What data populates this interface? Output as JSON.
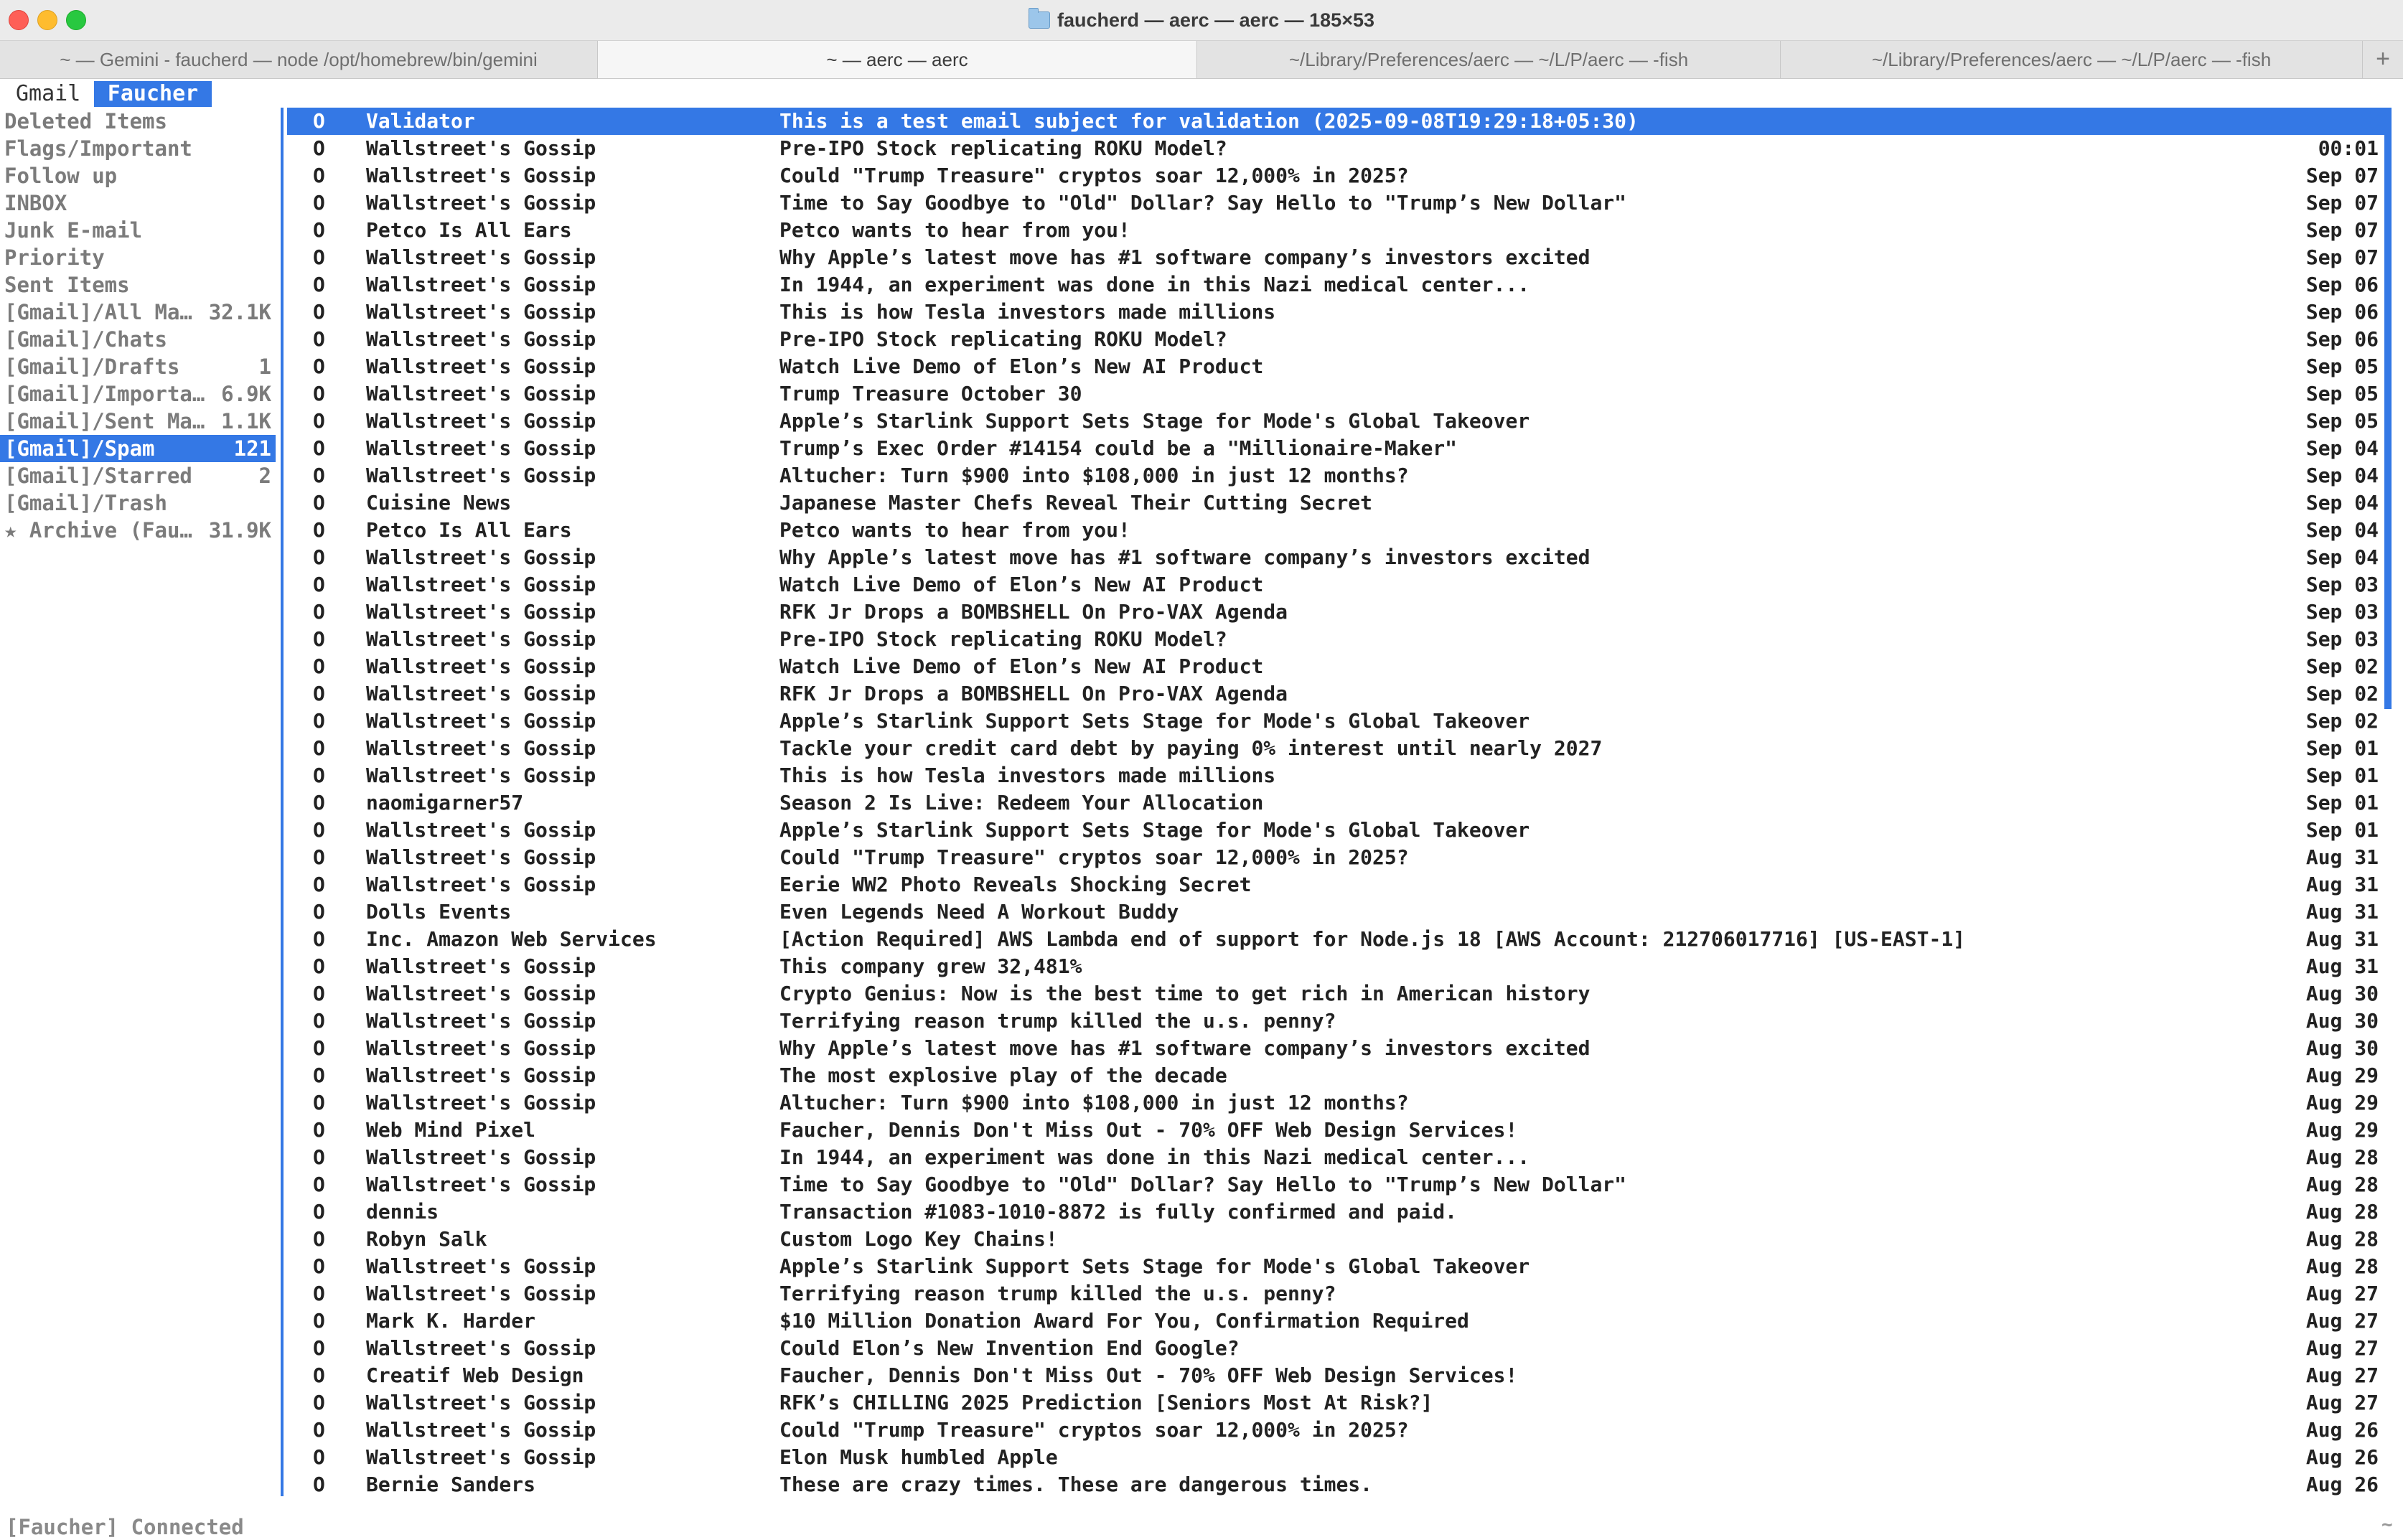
{
  "window": {
    "title": "faucherd — aerc — aerc — 185×53",
    "tabs": [
      {
        "label": "~ —  Gemini - faucherd  — node /opt/homebrew/bin/gemini"
      },
      {
        "label": "~ — aerc — aerc"
      },
      {
        "label": "~/Library/Preferences/aerc — ~/L/P/aerc — -fish"
      },
      {
        "label": "~/Library/Preferences/aerc — ~/L/P/aerc — -fish"
      }
    ],
    "new_tab_label": "+"
  },
  "accounts": [
    "Gmail",
    "Faucher"
  ],
  "folders": [
    {
      "name": "Deleted Items",
      "count": ""
    },
    {
      "name": "Flags/Important",
      "count": ""
    },
    {
      "name": "Follow up",
      "count": ""
    },
    {
      "name": "INBOX",
      "count": ""
    },
    {
      "name": "Junk E-mail",
      "count": ""
    },
    {
      "name": "Priority",
      "count": ""
    },
    {
      "name": "Sent Items",
      "count": ""
    },
    {
      "name": "[Gmail]/All Ma…",
      "count": "32.1K"
    },
    {
      "name": "[Gmail]/Chats",
      "count": ""
    },
    {
      "name": "[Gmail]/Drafts",
      "count": "1"
    },
    {
      "name": "[Gmail]/Importa…",
      "count": "6.9K"
    },
    {
      "name": "[Gmail]/Sent Ma…",
      "count": "1.1K"
    },
    {
      "name": "[Gmail]/Spam",
      "count": "121"
    },
    {
      "name": "[Gmail]/Starred",
      "count": "2"
    },
    {
      "name": "[Gmail]/Trash",
      "count": ""
    },
    {
      "name": "★ Archive (Fau…",
      "count": "31.9K"
    }
  ],
  "messages": [
    {
      "flag": "O",
      "from": "Validator",
      "subject": "This is a test email subject for validation (2025-09-08T19:29:18+05:30)",
      "date": ""
    },
    {
      "flag": "O",
      "from": "Wallstreet's Gossip",
      "subject": "Pre-IPO Stock replicating ROKU Model?",
      "date": "00:01"
    },
    {
      "flag": "O",
      "from": "Wallstreet's Gossip",
      "subject": "Could \"Trump Treasure\" cryptos soar 12,000% in 2025?",
      "date": "Sep 07"
    },
    {
      "flag": "O",
      "from": "Wallstreet's Gossip",
      "subject": "Time to Say Goodbye to \"Old\" Dollar? Say Hello to \"Trump’s New Dollar\"",
      "date": "Sep 07"
    },
    {
      "flag": "O",
      "from": "Petco Is All Ears",
      "subject": "Petco wants to hear from you!",
      "date": "Sep 07"
    },
    {
      "flag": "O",
      "from": "Wallstreet's Gossip",
      "subject": "Why Apple’s latest move has #1 software company’s investors excited",
      "date": "Sep 07"
    },
    {
      "flag": "O",
      "from": "Wallstreet's Gossip",
      "subject": "In 1944, an experiment was done in this Nazi medical center...",
      "date": "Sep 06"
    },
    {
      "flag": "O",
      "from": "Wallstreet's Gossip",
      "subject": "This is how Tesla investors made millions",
      "date": "Sep 06"
    },
    {
      "flag": "O",
      "from": "Wallstreet's Gossip",
      "subject": "Pre-IPO Stock replicating ROKU Model?",
      "date": "Sep 06"
    },
    {
      "flag": "O",
      "from": "Wallstreet's Gossip",
      "subject": "Watch Live Demo of Elon’s New AI Product",
      "date": "Sep 05"
    },
    {
      "flag": "O",
      "from": "Wallstreet's Gossip",
      "subject": "Trump Treasure October 30",
      "date": "Sep 05"
    },
    {
      "flag": "O",
      "from": "Wallstreet's Gossip",
      "subject": "Apple’s Starlink Support Sets Stage for Mode's Global Takeover",
      "date": "Sep 05"
    },
    {
      "flag": "O",
      "from": "Wallstreet's Gossip",
      "subject": "Trump’s Exec Order #14154 could be a \"Millionaire-Maker\"",
      "date": "Sep 04"
    },
    {
      "flag": "O",
      "from": "Wallstreet's Gossip",
      "subject": "Altucher: Turn $900 into $108,000 in just 12 months?",
      "date": "Sep 04"
    },
    {
      "flag": "O",
      "from": "Cuisine News",
      "subject": "Japanese Master Chefs Reveal Their Cutting Secret",
      "date": "Sep 04"
    },
    {
      "flag": "O",
      "from": "Petco Is All Ears",
      "subject": "Petco wants to hear from you!",
      "date": "Sep 04"
    },
    {
      "flag": "O",
      "from": "Wallstreet's Gossip",
      "subject": "Why Apple’s latest move has #1 software company’s investors excited",
      "date": "Sep 04"
    },
    {
      "flag": "O",
      "from": "Wallstreet's Gossip",
      "subject": "Watch Live Demo of Elon’s New AI Product",
      "date": "Sep 03"
    },
    {
      "flag": "O",
      "from": "Wallstreet's Gossip",
      "subject": "RFK Jr Drops a BOMBSHELL On Pro-VAX Agenda",
      "date": "Sep 03"
    },
    {
      "flag": "O",
      "from": "Wallstreet's Gossip",
      "subject": "Pre-IPO Stock replicating ROKU Model?",
      "date": "Sep 03"
    },
    {
      "flag": "O",
      "from": "Wallstreet's Gossip",
      "subject": "Watch Live Demo of Elon’s New AI Product",
      "date": "Sep 02"
    },
    {
      "flag": "O",
      "from": "Wallstreet's Gossip",
      "subject": "RFK Jr Drops a BOMBSHELL On Pro-VAX Agenda",
      "date": "Sep 02"
    },
    {
      "flag": "O",
      "from": "Wallstreet's Gossip",
      "subject": "Apple’s Starlink Support Sets Stage for Mode's Global Takeover",
      "date": "Sep 02"
    },
    {
      "flag": "O",
      "from": "Wallstreet's Gossip",
      "subject": "Tackle your credit card debt by paying 0% interest until nearly 2027",
      "date": "Sep 01"
    },
    {
      "flag": "O",
      "from": "Wallstreet's Gossip",
      "subject": "This is how Tesla investors made millions",
      "date": "Sep 01"
    },
    {
      "flag": "O",
      "from": "naomigarner57",
      "subject": "Season 2 Is Live: Redeem Your Allocation",
      "date": "Sep 01"
    },
    {
      "flag": "O",
      "from": "Wallstreet's Gossip",
      "subject": "Apple’s Starlink Support Sets Stage for Mode's Global Takeover",
      "date": "Sep 01"
    },
    {
      "flag": "O",
      "from": "Wallstreet's Gossip",
      "subject": "Could \"Trump Treasure\" cryptos soar 12,000% in 2025?",
      "date": "Aug 31"
    },
    {
      "flag": "O",
      "from": "Wallstreet's Gossip",
      "subject": "Eerie WW2 Photo Reveals Shocking Secret",
      "date": "Aug 31"
    },
    {
      "flag": "O",
      "from": "Dolls Events",
      "subject": "Even Legends Need A Workout Buddy",
      "date": "Aug 31"
    },
    {
      "flag": "O",
      "from": "Inc. Amazon Web Services",
      "subject": "[Action Required] AWS Lambda end of support for Node.js 18 [AWS Account: 212706017716] [US-EAST-1]",
      "date": "Aug 31"
    },
    {
      "flag": "O",
      "from": "Wallstreet's Gossip",
      "subject": "This company grew 32,481%",
      "date": "Aug 31"
    },
    {
      "flag": "O",
      "from": "Wallstreet's Gossip",
      "subject": "Crypto Genius: Now is the best time to get rich in American history",
      "date": "Aug 30"
    },
    {
      "flag": "O",
      "from": "Wallstreet's Gossip",
      "subject": "Terrifying reason trump killed the u.s. penny?",
      "date": "Aug 30"
    },
    {
      "flag": "O",
      "from": "Wallstreet's Gossip",
      "subject": "Why Apple’s latest move has #1 software company’s investors excited",
      "date": "Aug 30"
    },
    {
      "flag": "O",
      "from": "Wallstreet's Gossip",
      "subject": "The most explosive play of the decade",
      "date": "Aug 29"
    },
    {
      "flag": "O",
      "from": "Wallstreet's Gossip",
      "subject": "Altucher: Turn $900 into $108,000 in just 12 months?",
      "date": "Aug 29"
    },
    {
      "flag": "O",
      "from": "Web Mind Pixel",
      "subject": "Faucher, Dennis Don't Miss Out - 70% OFF Web Design Services!",
      "date": "Aug 29"
    },
    {
      "flag": "O",
      "from": "Wallstreet's Gossip",
      "subject": "In 1944, an experiment was done in this Nazi medical center...",
      "date": "Aug 28"
    },
    {
      "flag": "O",
      "from": "Wallstreet's Gossip",
      "subject": "Time to Say Goodbye to \"Old\" Dollar? Say Hello to \"Trump’s New Dollar\"",
      "date": "Aug 28"
    },
    {
      "flag": "O",
      "from": "dennis",
      "subject": "Transaction #1083-1010-8872 is fully confirmed and paid.",
      "date": "Aug 28"
    },
    {
      "flag": "O",
      "from": "Robyn Salk",
      "subject": "Custom Logo Key Chains!",
      "date": "Aug 28"
    },
    {
      "flag": "O",
      "from": "Wallstreet's Gossip",
      "subject": "Apple’s Starlink Support Sets Stage for Mode's Global Takeover",
      "date": "Aug 28"
    },
    {
      "flag": "O",
      "from": "Wallstreet's Gossip",
      "subject": "Terrifying reason trump killed the u.s. penny?",
      "date": "Aug 27"
    },
    {
      "flag": "O",
      "from": "Mark K. Harder",
      "subject": "$10 Million Donation Award For You, Confirmation Required",
      "date": "Aug 27"
    },
    {
      "flag": "O",
      "from": "Wallstreet's Gossip",
      "subject": "Could Elon’s New Invention End Google?",
      "date": "Aug 27"
    },
    {
      "flag": "O",
      "from": "Creatif Web Design",
      "subject": "Faucher, Dennis Don't Miss Out - 70% OFF Web Design Services!",
      "date": "Aug 27"
    },
    {
      "flag": "O",
      "from": "Wallstreet's Gossip",
      "subject": "RFK’s CHILLING 2025 Prediction [Seniors Most At Risk?]",
      "date": "Aug 27"
    },
    {
      "flag": "O",
      "from": "Wallstreet's Gossip",
      "subject": "Could \"Trump Treasure\" cryptos soar 12,000% in 2025?",
      "date": "Aug 26"
    },
    {
      "flag": "O",
      "from": "Wallstreet's Gossip",
      "subject": "Elon Musk humbled Apple",
      "date": "Aug 26"
    },
    {
      "flag": "O",
      "from": "Bernie Sanders",
      "subject": "These are crazy times. These are dangerous times.",
      "date": "Aug 26"
    }
  ],
  "status": "[Faucher] Connected",
  "corner_mark": "~",
  "colors": {
    "accent": "#3478e5"
  }
}
